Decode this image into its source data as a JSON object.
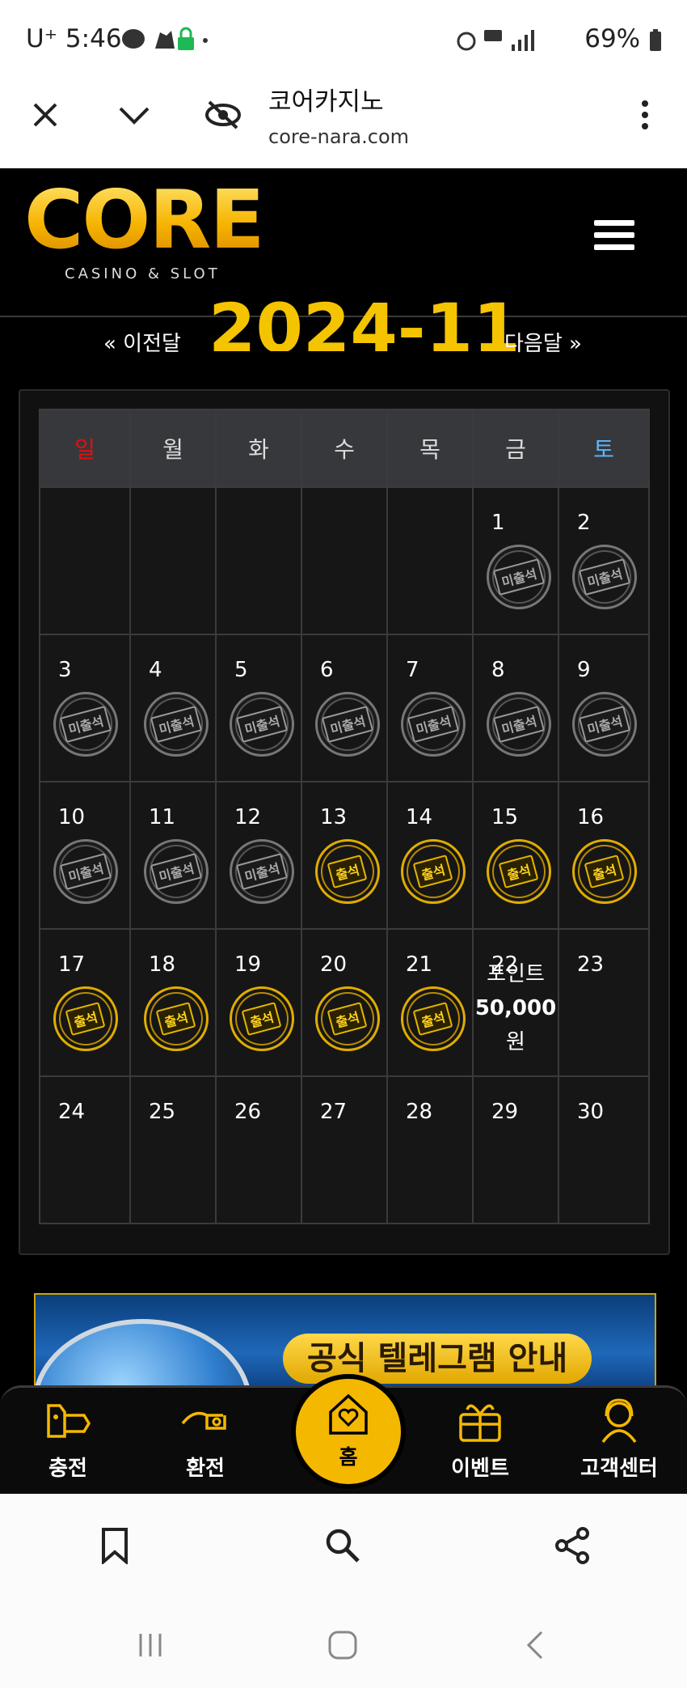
{
  "status_bar": {
    "time": "5:46",
    "carrier": "U⁺",
    "network": "5G",
    "battery": "69%"
  },
  "browser": {
    "page_title": "코어카지노",
    "url": "core-nara.com"
  },
  "site": {
    "logo_text": "CORE",
    "logo_subtitle": "CASINO & SLOT"
  },
  "calendar": {
    "prev_label": "« 이전달",
    "next_label": "다음달 »",
    "month_title": "2024-11",
    "weekdays": [
      "일",
      "월",
      "화",
      "수",
      "목",
      "금",
      "토"
    ],
    "sunday_color": "#e01010",
    "saturday_color": "#5ab8ff",
    "stamp_absent_label": "미출석",
    "stamp_present_label": "출석",
    "weeks": [
      [
        null,
        null,
        null,
        null,
        null,
        {
          "day": "1",
          "stamp": "absent"
        },
        {
          "day": "2",
          "stamp": "absent"
        }
      ],
      [
        {
          "day": "3",
          "stamp": "absent"
        },
        {
          "day": "4",
          "stamp": "absent"
        },
        {
          "day": "5",
          "stamp": "absent"
        },
        {
          "day": "6",
          "stamp": "absent"
        },
        {
          "day": "7",
          "stamp": "absent"
        },
        {
          "day": "8",
          "stamp": "absent"
        },
        {
          "day": "9",
          "stamp": "absent"
        }
      ],
      [
        {
          "day": "10",
          "stamp": "absent"
        },
        {
          "day": "11",
          "stamp": "absent"
        },
        {
          "day": "12",
          "stamp": "absent"
        },
        {
          "day": "13",
          "stamp": "present"
        },
        {
          "day": "14",
          "stamp": "present"
        },
        {
          "day": "15",
          "stamp": "present"
        },
        {
          "day": "16",
          "stamp": "present"
        }
      ],
      [
        {
          "day": "17",
          "stamp": "present"
        },
        {
          "day": "18",
          "stamp": "present"
        },
        {
          "day": "19",
          "stamp": "present"
        },
        {
          "day": "20",
          "stamp": "present"
        },
        {
          "day": "21",
          "stamp": "present"
        },
        {
          "day": "22",
          "reward": [
            "포인트",
            "50,000",
            "원"
          ]
        },
        {
          "day": "23"
        }
      ],
      [
        {
          "day": "24"
        },
        {
          "day": "25"
        },
        {
          "day": "26"
        },
        {
          "day": "27"
        },
        {
          "day": "28"
        },
        {
          "day": "29"
        },
        {
          "day": "30"
        }
      ]
    ]
  },
  "banner": {
    "text": "공식 텔레그램 안내"
  },
  "bottom_nav": {
    "items": [
      {
        "label": "충전",
        "icon": "deposit-icon"
      },
      {
        "label": "환전",
        "icon": "withdraw-icon"
      },
      {
        "label": "홈",
        "icon": "home-heart-icon"
      },
      {
        "label": "이벤트",
        "icon": "gift-icon"
      },
      {
        "label": "고객센터",
        "icon": "support-icon"
      }
    ]
  }
}
